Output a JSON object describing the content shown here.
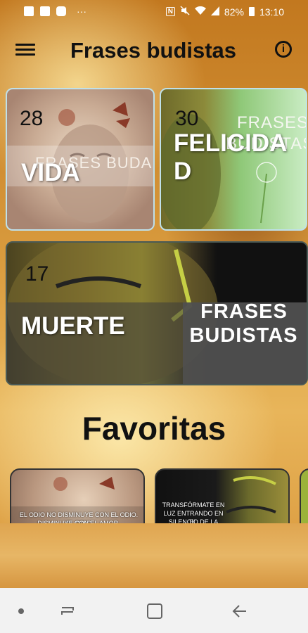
{
  "status_bar": {
    "battery": "82%",
    "time": "13:10",
    "left_icons": [
      "gallery-icon",
      "dropbox-icon",
      "app-icon",
      "more-icon"
    ],
    "right_icons": [
      "nfc-icon",
      "mute-icon",
      "wifi-icon",
      "signal-icon",
      "battery-icon"
    ],
    "more": "···"
  },
  "app_bar": {
    "title": "Frases budistas",
    "menu_icon": "hamburger-menu-icon",
    "info_icon": "info-icon",
    "info_glyph": "i"
  },
  "categories": [
    {
      "count": "28",
      "label": "VIDA",
      "image_text": "FRASES BUDA"
    },
    {
      "count": "30",
      "label_line1": "FELICIDA",
      "label_line2": "D",
      "image_text_line1": "FRASES",
      "image_text_line2": "BUDISTAS"
    },
    {
      "count": "17",
      "label": "MUERTE",
      "image_text_line1": "FRASES",
      "image_text_line2": "BUDISTAS"
    }
  ],
  "favorites": {
    "title": "Favoritas",
    "items": [
      {
        "text_line1": "EL ODIO NO DISMINUYE CON EL ODIO. EL ODIO",
        "text_line2": "DISMINUYE CON EL AMOR."
      },
      {
        "text_line1": "TRANSFÓRMATE EN",
        "text_line2": "LUZ ENTRANDO EN EL",
        "text_line3": "SILENCIO DE LA"
      }
    ]
  },
  "nav_bar": {
    "items": [
      "dot-icon",
      "recents-icon",
      "home-icon",
      "back-icon"
    ]
  },
  "colors": {
    "background": "#d89a3d",
    "title": "#111111",
    "nav_bar": "#f2f2f2"
  }
}
